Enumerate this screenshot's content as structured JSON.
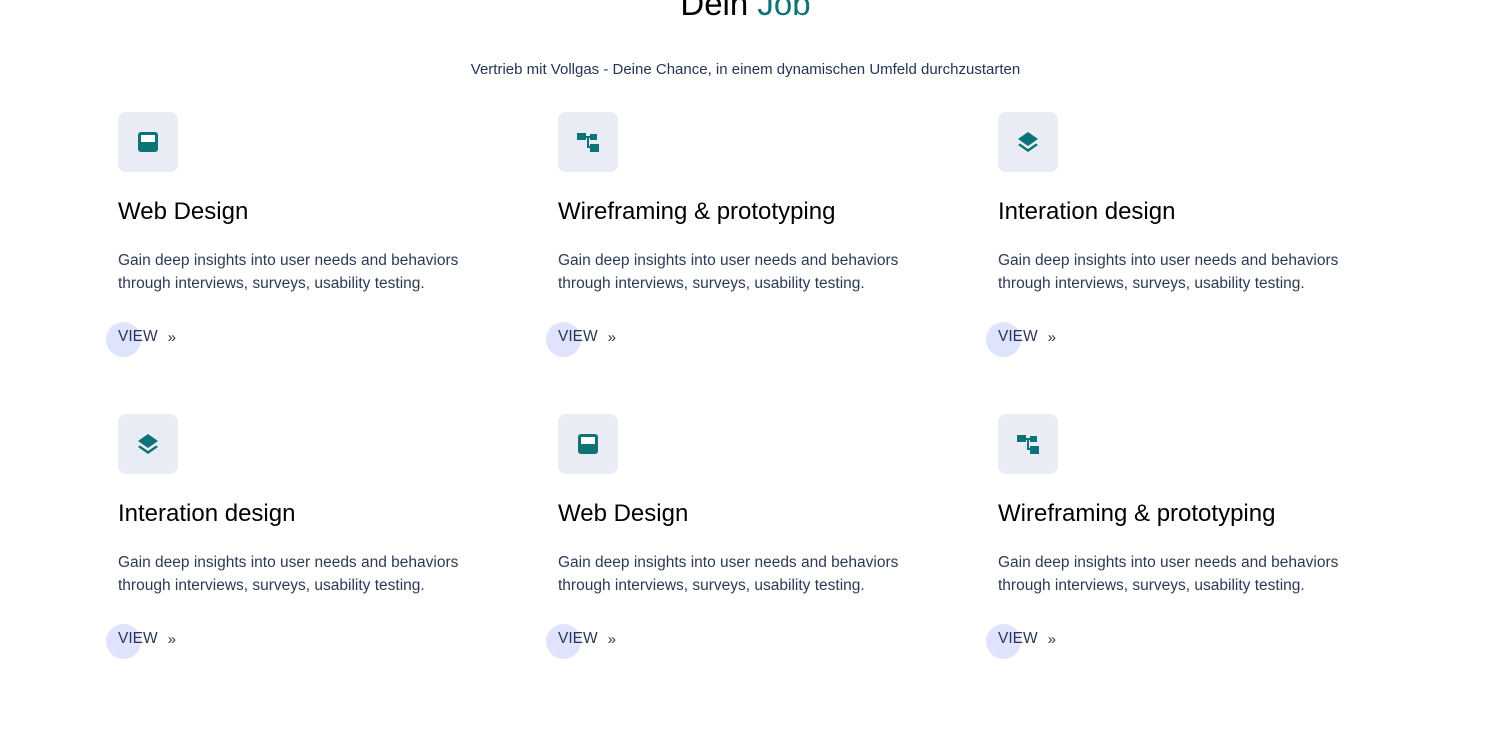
{
  "header": {
    "title_prefix": "Dein",
    "title_accent": "Job",
    "subtitle": "Vertrieb mit Vollgas - Deine Chance, in einem dynamischen Umfeld durchzustarten"
  },
  "colors": {
    "accent": "#0d7377",
    "icon_bg": "#e9ecf5",
    "link_blob": "#dfe3fb",
    "text": "#2d3a56"
  },
  "cards": [
    {
      "icon": "web-layout-icon",
      "title": "Web Design",
      "description": "Gain deep insights into user needs and behaviors through interviews, surveys, usability testing.",
      "link_label": "VIEW",
      "link_arrow": "»"
    },
    {
      "icon": "sitemap-icon",
      "title": "Wireframing & prototyping",
      "description": "Gain deep insights into user needs and behaviors through interviews, surveys, usability testing.",
      "link_label": "VIEW",
      "link_arrow": "»"
    },
    {
      "icon": "layers-icon",
      "title": "Interation design",
      "description": "Gain deep insights into user needs and behaviors through interviews, surveys, usability testing.",
      "link_label": "VIEW",
      "link_arrow": "»"
    },
    {
      "icon": "layers-icon",
      "title": "Interation design",
      "description": "Gain deep insights into user needs and behaviors through interviews, surveys, usability testing.",
      "link_label": "VIEW",
      "link_arrow": "»"
    },
    {
      "icon": "web-layout-icon",
      "title": "Web Design",
      "description": "Gain deep insights into user needs and behaviors through interviews, surveys, usability testing.",
      "link_label": "VIEW",
      "link_arrow": "»"
    },
    {
      "icon": "sitemap-icon",
      "title": "Wireframing & prototyping",
      "description": "Gain deep insights into user needs and behaviors through interviews, surveys, usability testing.",
      "link_label": "VIEW",
      "link_arrow": "»"
    }
  ]
}
